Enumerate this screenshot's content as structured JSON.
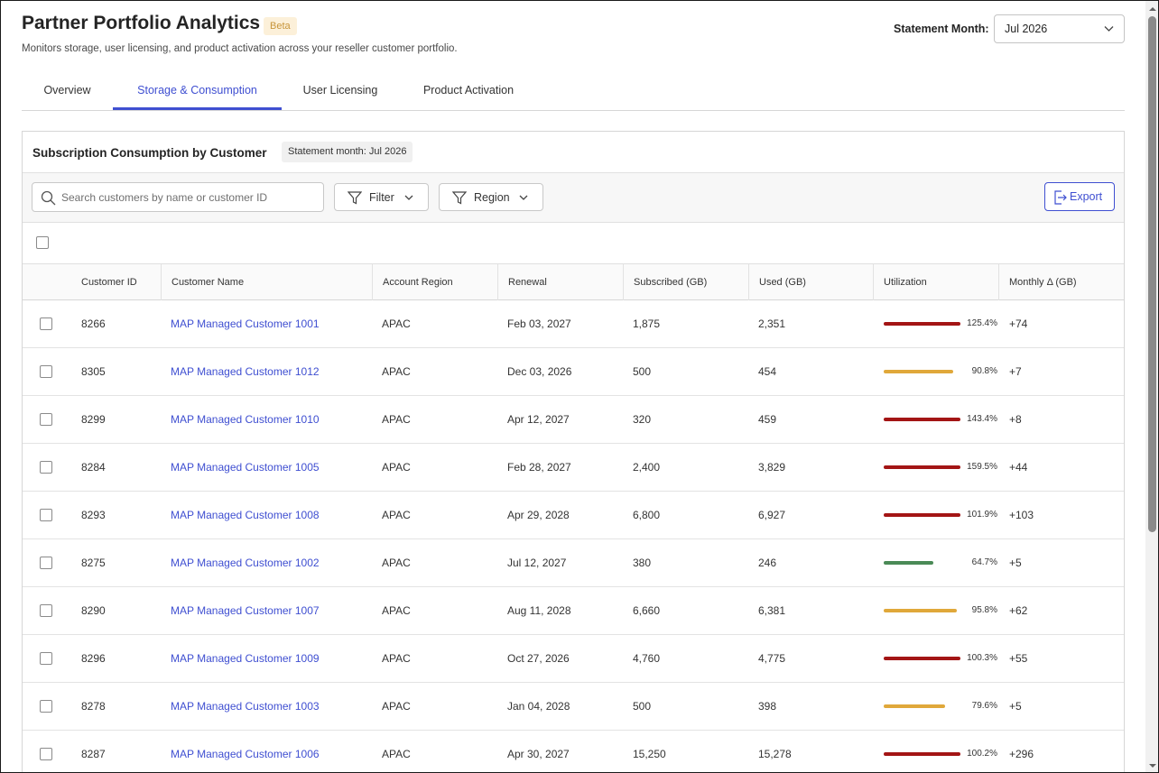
{
  "header": {
    "title": "Partner Portfolio Analytics",
    "badge": "Beta",
    "subtitle": "Monitors storage, user licensing, and product activation across your reseller customer portfolio.",
    "statement_month_label": "Statement Month:",
    "statement_month_value": "Jul 2026"
  },
  "tabs": [
    {
      "label": "Overview",
      "active": false
    },
    {
      "label": "Storage & Consumption",
      "active": true
    },
    {
      "label": "User Licensing",
      "active": false
    },
    {
      "label": "Product Activation",
      "active": false
    }
  ],
  "card": {
    "title": "Subscription Consumption by Customer",
    "chip": "Statement month: Jul 2026"
  },
  "toolbar": {
    "search_placeholder": "Search customers by name or customer ID",
    "filter_label": "Filter",
    "region_label": "Region",
    "export_label": "Export"
  },
  "table": {
    "columns": [
      "Customer ID",
      "Customer Name",
      "Account Region",
      "Renewal",
      "Subscribed (GB)",
      "Used (GB)",
      "Utilization",
      "Monthly Δ (GB)"
    ],
    "rows": [
      {
        "id": "8266",
        "name": "MAP Managed Customer 1001",
        "region": "APAC",
        "renewal": "Feb 03, 2027",
        "subscribed": "1,875",
        "used": "2,351",
        "utilization": "125.4%",
        "util_fraction": 1.0,
        "status": "over",
        "delta": "+74"
      },
      {
        "id": "8305",
        "name": "MAP Managed Customer 1012",
        "region": "APAC",
        "renewal": "Dec 03, 2026",
        "subscribed": "500",
        "used": "454",
        "utilization": "90.8%",
        "util_fraction": 0.908,
        "status": "warn",
        "delta": "+7"
      },
      {
        "id": "8299",
        "name": "MAP Managed Customer 1010",
        "region": "APAC",
        "renewal": "Apr 12, 2027",
        "subscribed": "320",
        "used": "459",
        "utilization": "143.4%",
        "util_fraction": 1.0,
        "status": "over",
        "delta": "+8"
      },
      {
        "id": "8284",
        "name": "MAP Managed Customer 1005",
        "region": "APAC",
        "renewal": "Feb 28, 2027",
        "subscribed": "2,400",
        "used": "3,829",
        "utilization": "159.5%",
        "util_fraction": 1.0,
        "status": "over",
        "delta": "+44"
      },
      {
        "id": "8293",
        "name": "MAP Managed Customer 1008",
        "region": "APAC",
        "renewal": "Apr 29, 2028",
        "subscribed": "6,800",
        "used": "6,927",
        "utilization": "101.9%",
        "util_fraction": 1.0,
        "status": "over",
        "delta": "+103"
      },
      {
        "id": "8275",
        "name": "MAP Managed Customer 1002",
        "region": "APAC",
        "renewal": "Jul 12, 2027",
        "subscribed": "380",
        "used": "246",
        "utilization": "64.7%",
        "util_fraction": 0.647,
        "status": "ok",
        "delta": "+5"
      },
      {
        "id": "8290",
        "name": "MAP Managed Customer 1007",
        "region": "APAC",
        "renewal": "Aug 11, 2028",
        "subscribed": "6,660",
        "used": "6,381",
        "utilization": "95.8%",
        "util_fraction": 0.958,
        "status": "warn",
        "delta": "+62"
      },
      {
        "id": "8296",
        "name": "MAP Managed Customer 1009",
        "region": "APAC",
        "renewal": "Oct 27, 2026",
        "subscribed": "4,760",
        "used": "4,775",
        "utilization": "100.3%",
        "util_fraction": 1.0,
        "status": "over",
        "delta": "+55"
      },
      {
        "id": "8278",
        "name": "MAP Managed Customer 1003",
        "region": "APAC",
        "renewal": "Jan 04, 2028",
        "subscribed": "500",
        "used": "398",
        "utilization": "79.6%",
        "util_fraction": 0.796,
        "status": "warn",
        "delta": "+5"
      },
      {
        "id": "8287",
        "name": "MAP Managed Customer 1006",
        "region": "APAC",
        "renewal": "Apr 30, 2027",
        "subscribed": "15,250",
        "used": "15,278",
        "utilization": "100.2%",
        "util_fraction": 1.0,
        "status": "over",
        "delta": "+296"
      }
    ]
  },
  "colors": {
    "accent": "#3f4fd1",
    "over": "#a31515",
    "warn": "#e0a83a",
    "ok": "#4a8a56"
  }
}
